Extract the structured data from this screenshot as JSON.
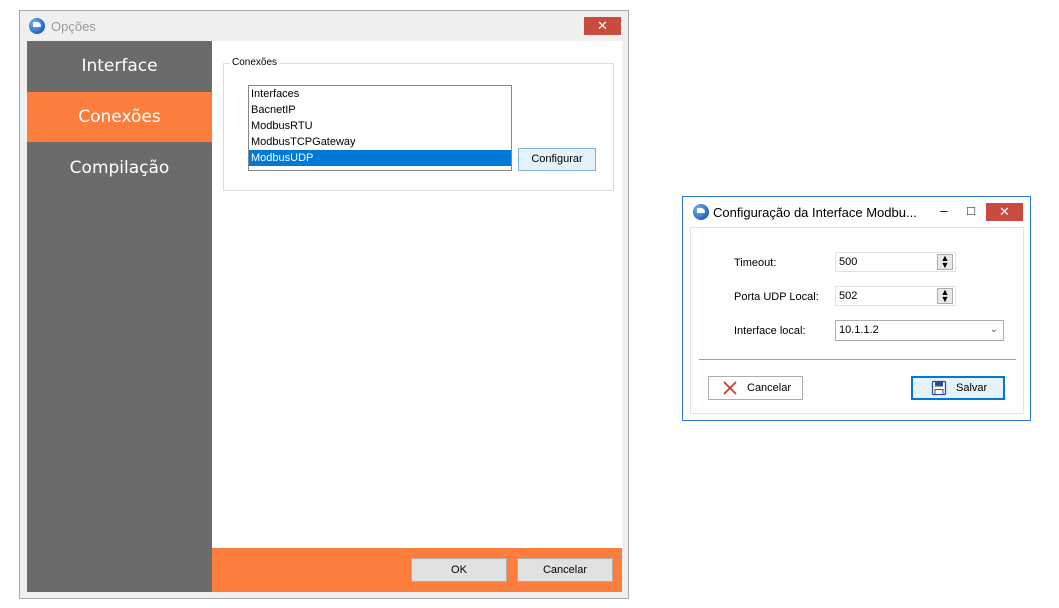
{
  "main_window": {
    "title": "Opções",
    "close_glyph": "✕",
    "nav": [
      "Interface",
      "Conexões",
      "Compilação"
    ],
    "active_nav": "Conexões",
    "group_title": "Conexões",
    "list_items": [
      "Interfaces",
      "BacnetIP",
      "ModbusRTU",
      "ModbusTCPGateway",
      "ModbusUDP"
    ],
    "selected_item": "ModbusUDP",
    "configure_label": "Configurar",
    "ok_label": "OK",
    "cancel_label": "Cancelar"
  },
  "dialog": {
    "title": "Configuração da Interface Modbu...",
    "minimize_glyph": "–",
    "maximize_glyph": "□",
    "close_glyph": "✕",
    "timeout_label": "Timeout:",
    "timeout_value": "500",
    "port_label": "Porta UDP Local:",
    "port_value": "502",
    "interface_label": "Interface local:",
    "interface_value": "10.1.1.2",
    "cancel_label": "Cancelar",
    "save_label": "Salvar"
  },
  "colors": {
    "accent_orange": "#fc7d3c",
    "nav_gray": "#6b6b6b",
    "selection_blue": "#0078d7",
    "close_red": "#c94a3f"
  },
  "icons": [
    "app-logo-icon",
    "close-icon",
    "minimize-icon",
    "maximize-icon",
    "spin-arrows-icon",
    "chevron-down-icon",
    "cancel-x-icon",
    "save-disk-icon"
  ]
}
